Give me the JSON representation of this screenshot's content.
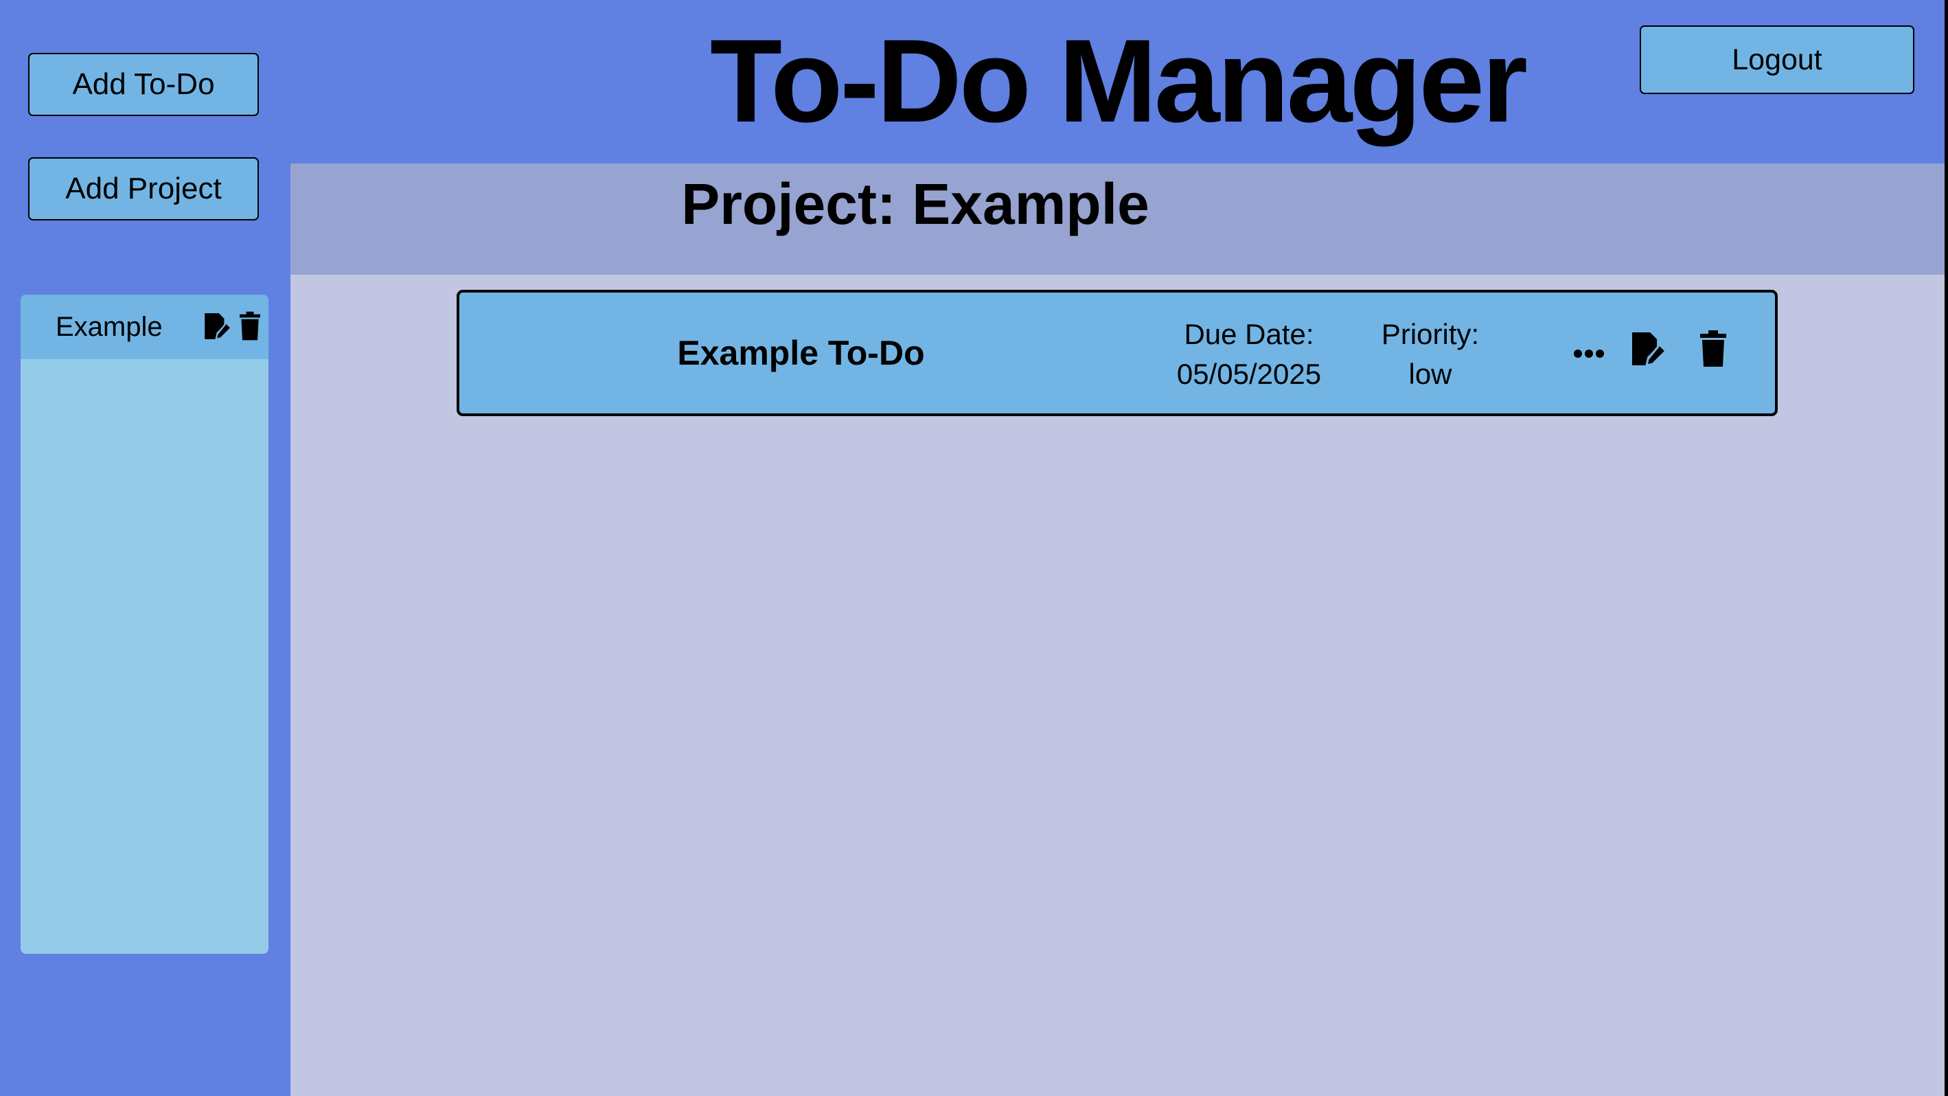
{
  "app": {
    "title": "To-Do Manager"
  },
  "header": {
    "logout_label": "Logout"
  },
  "sidebar": {
    "add_todo_label": "Add To-Do",
    "add_project_label": "Add Project",
    "projects": [
      {
        "name": "Example",
        "icons": [
          "edit-icon",
          "trash-icon"
        ]
      }
    ]
  },
  "main": {
    "project_heading": "Project: Example",
    "todos": [
      {
        "title": "Example To-Do",
        "due_label": "Due Date:",
        "due_value": "05/05/2025",
        "priority_label": "Priority:",
        "priority_value": "low",
        "icons": [
          "more-icon",
          "edit-icon",
          "trash-icon"
        ]
      }
    ]
  },
  "colors": {
    "background": "#6080e2",
    "button": "#72b5e4",
    "project_panel": "#94cbe8",
    "main_content": "#c2c6e2",
    "project_header": "#97a3d0"
  }
}
